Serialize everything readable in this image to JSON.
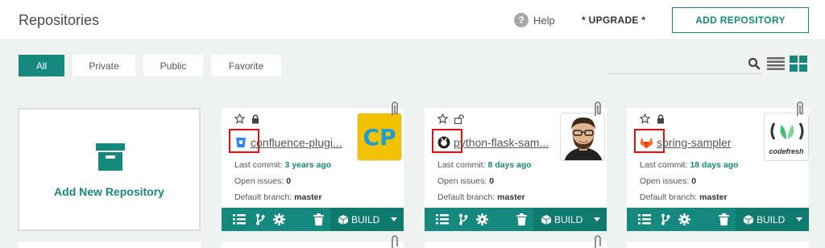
{
  "header": {
    "title": "Repositories",
    "help_label": "Help",
    "upgrade_label": "* UPGRADE *",
    "add_repo_label": "ADD REPOSITORY"
  },
  "filters": [
    {
      "label": "All",
      "active": true
    },
    {
      "label": "Private",
      "active": false
    },
    {
      "label": "Public",
      "active": false
    },
    {
      "label": "Favorite",
      "active": false
    }
  ],
  "add_card": {
    "label": "Add New Repository"
  },
  "repos": [
    {
      "name": "confluence-plugi...",
      "provider": "bitbucket",
      "locked": true,
      "last_commit_label": "Last commit:",
      "last_commit": "3 years ago",
      "open_issues_label": "Open issues:",
      "open_issues": "0",
      "branch_label": "Default branch:",
      "branch": "master",
      "avatar_text": "CP",
      "build_label": "BUILD"
    },
    {
      "name": "python-flask-sam...",
      "provider": "github",
      "locked": false,
      "last_commit_label": "Last commit:",
      "last_commit": "8 days ago",
      "open_issues_label": "Open issues:",
      "open_issues": "0",
      "branch_label": "Default branch:",
      "branch": "master",
      "avatar_text": "",
      "build_label": "BUILD"
    },
    {
      "name": "spring-sampler",
      "provider": "gitlab",
      "locked": true,
      "last_commit_label": "Last commit:",
      "last_commit": "18 days ago",
      "open_issues_label": "Open issues:",
      "open_issues": "0",
      "branch_label": "Default branch:",
      "branch": "master",
      "avatar_text": "codefresh",
      "build_label": "BUILD"
    }
  ],
  "colors": {
    "accent": "#15897d",
    "highlight": "#e01010"
  }
}
